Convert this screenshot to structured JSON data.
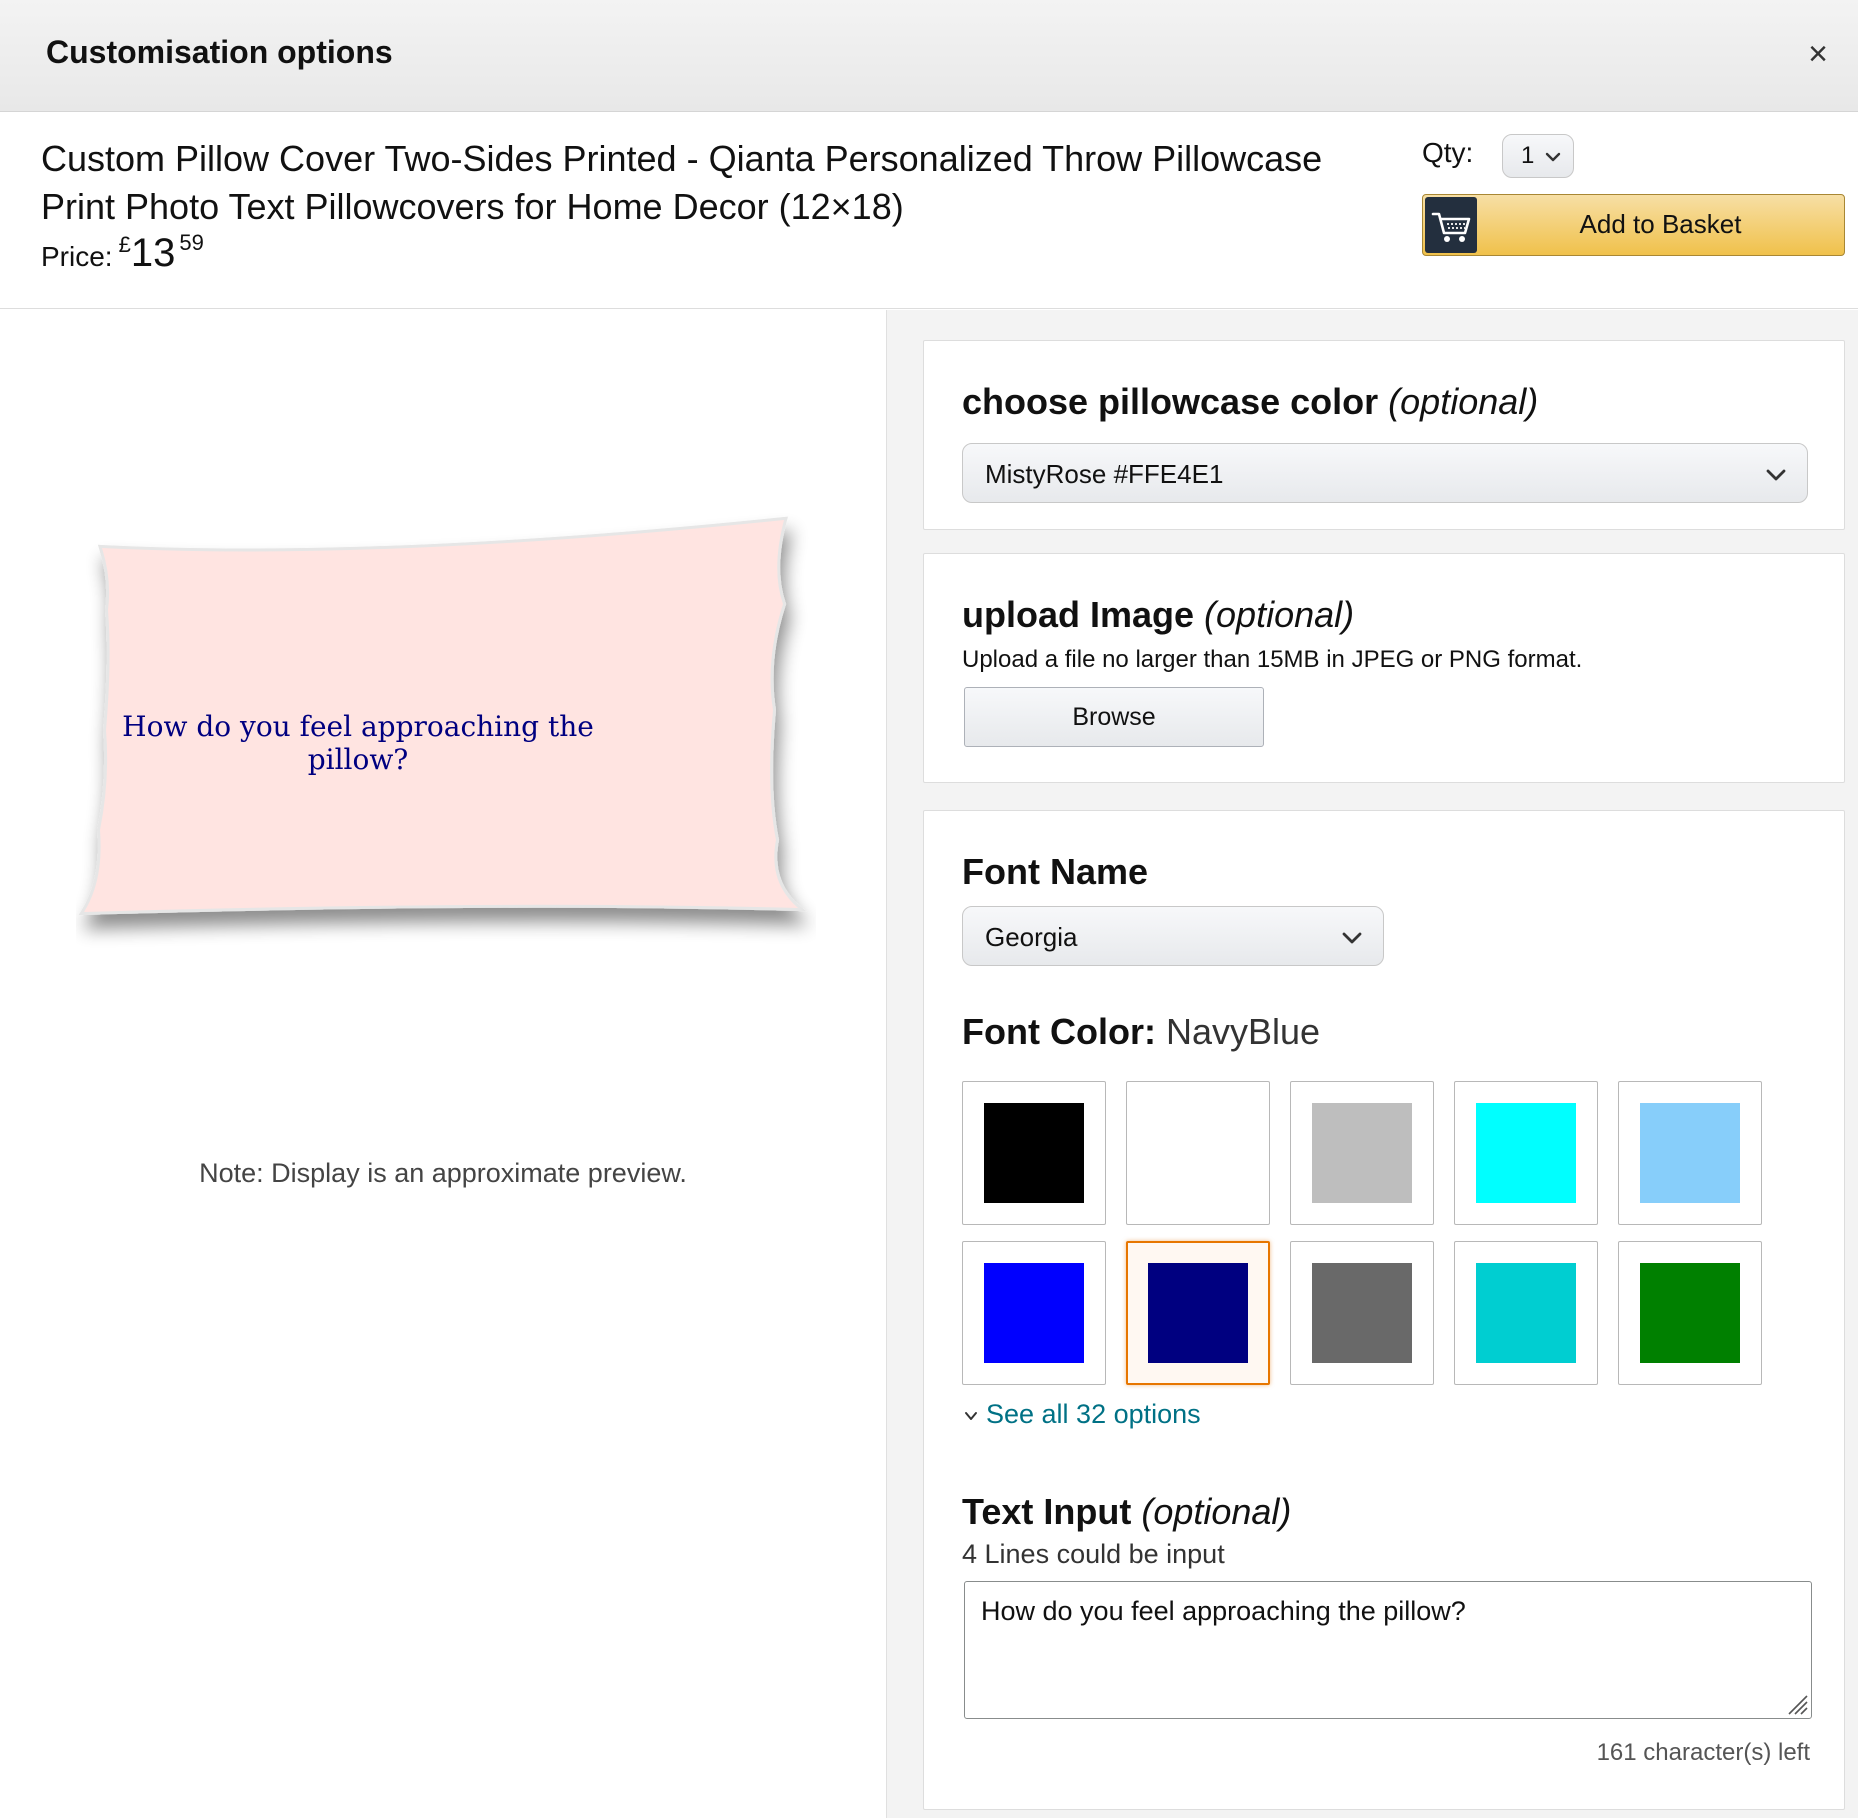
{
  "header": {
    "title": "Customisation options",
    "close_glyph": "×"
  },
  "product": {
    "title": "Custom Pillow Cover Two-Sides Printed - Qianta Personalized Throw Pillowcase Print Photo Text Pillowcovers for Home Decor (12×18)",
    "price_label": "Price:",
    "price_symbol": "£",
    "price_whole": "13",
    "price_fraction": "59"
  },
  "purchase": {
    "qty_label": "Qty:",
    "qty_value": "1",
    "add_to_basket": "Add to Basket",
    "cart_icon": "cart-icon"
  },
  "preview": {
    "pillow_color": "#FFE4E1",
    "text": "How do you feel approaching the pillow?",
    "text_color": "#000080",
    "note": "Note: Display is an approximate preview."
  },
  "pillowcase_color": {
    "heading": "choose pillowcase color",
    "optional": "(optional)",
    "selected": "MistyRose #FFE4E1"
  },
  "upload": {
    "heading": "upload Image",
    "optional": "(optional)",
    "help": "Upload a file no larger than 15MB in JPEG or PNG format.",
    "browse_label": "Browse"
  },
  "font": {
    "name_heading": "Font Name",
    "name_value": "Georgia",
    "color_heading": "Font Color:",
    "color_value": "NavyBlue",
    "swatches": [
      {
        "color": "#000000"
      },
      {
        "color": "#FFFFFF"
      },
      {
        "color": "#BEBEBE"
      },
      {
        "color": "#00FFFF"
      },
      {
        "color": "#87CEFA"
      },
      {
        "color": "#0000FF"
      },
      {
        "color": "#000080",
        "selected": true
      },
      {
        "color": "#696969"
      },
      {
        "color": "#00CED1"
      },
      {
        "color": "#008000"
      }
    ],
    "see_all": "See all 32 options"
  },
  "text_input": {
    "heading": "Text Input",
    "optional": "(optional)",
    "help": "4 Lines could be input",
    "value": "How do you feel approaching the pillow?",
    "chars_left": "161 character(s) left"
  }
}
